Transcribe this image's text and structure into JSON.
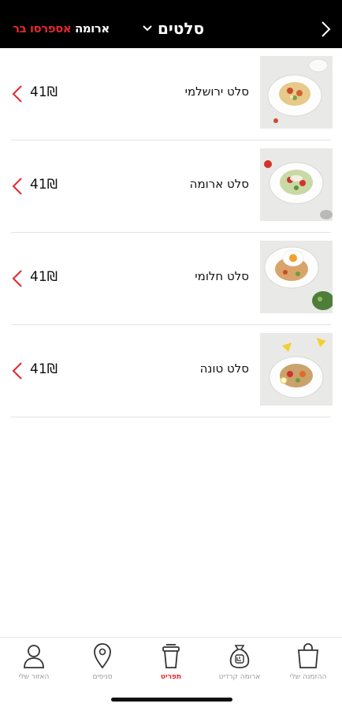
{
  "header": {
    "brand_white": "ארומה",
    "brand_red": "אספרסו בר",
    "title": "סלטים",
    "colors": {
      "background": "#000000",
      "accent": "#e3262e"
    }
  },
  "items": [
    {
      "name": "סלט ירושלמי",
      "price": "41₪",
      "image": "salad-plate-image"
    },
    {
      "name": "סלט ארומה",
      "price": "41₪",
      "image": "salad-plate-image"
    },
    {
      "name": "סלט חלומי",
      "price": "41₪",
      "image": "salad-with-egg-image"
    },
    {
      "name": "סלט טונה",
      "price": "41₪",
      "image": "salad-plate-image"
    }
  ],
  "tabs": [
    {
      "label": "ההזמנה שלי",
      "icon": "shopping-bag-icon",
      "active": false
    },
    {
      "label": "ארומה קרדיט",
      "icon": "money-bag-icon",
      "active": false
    },
    {
      "label": "תפריט",
      "icon": "coffee-cup-icon",
      "active": true
    },
    {
      "label": "סניפים",
      "icon": "location-pin-icon",
      "active": false
    },
    {
      "label": "האזור שלי",
      "icon": "user-icon",
      "active": false
    }
  ]
}
